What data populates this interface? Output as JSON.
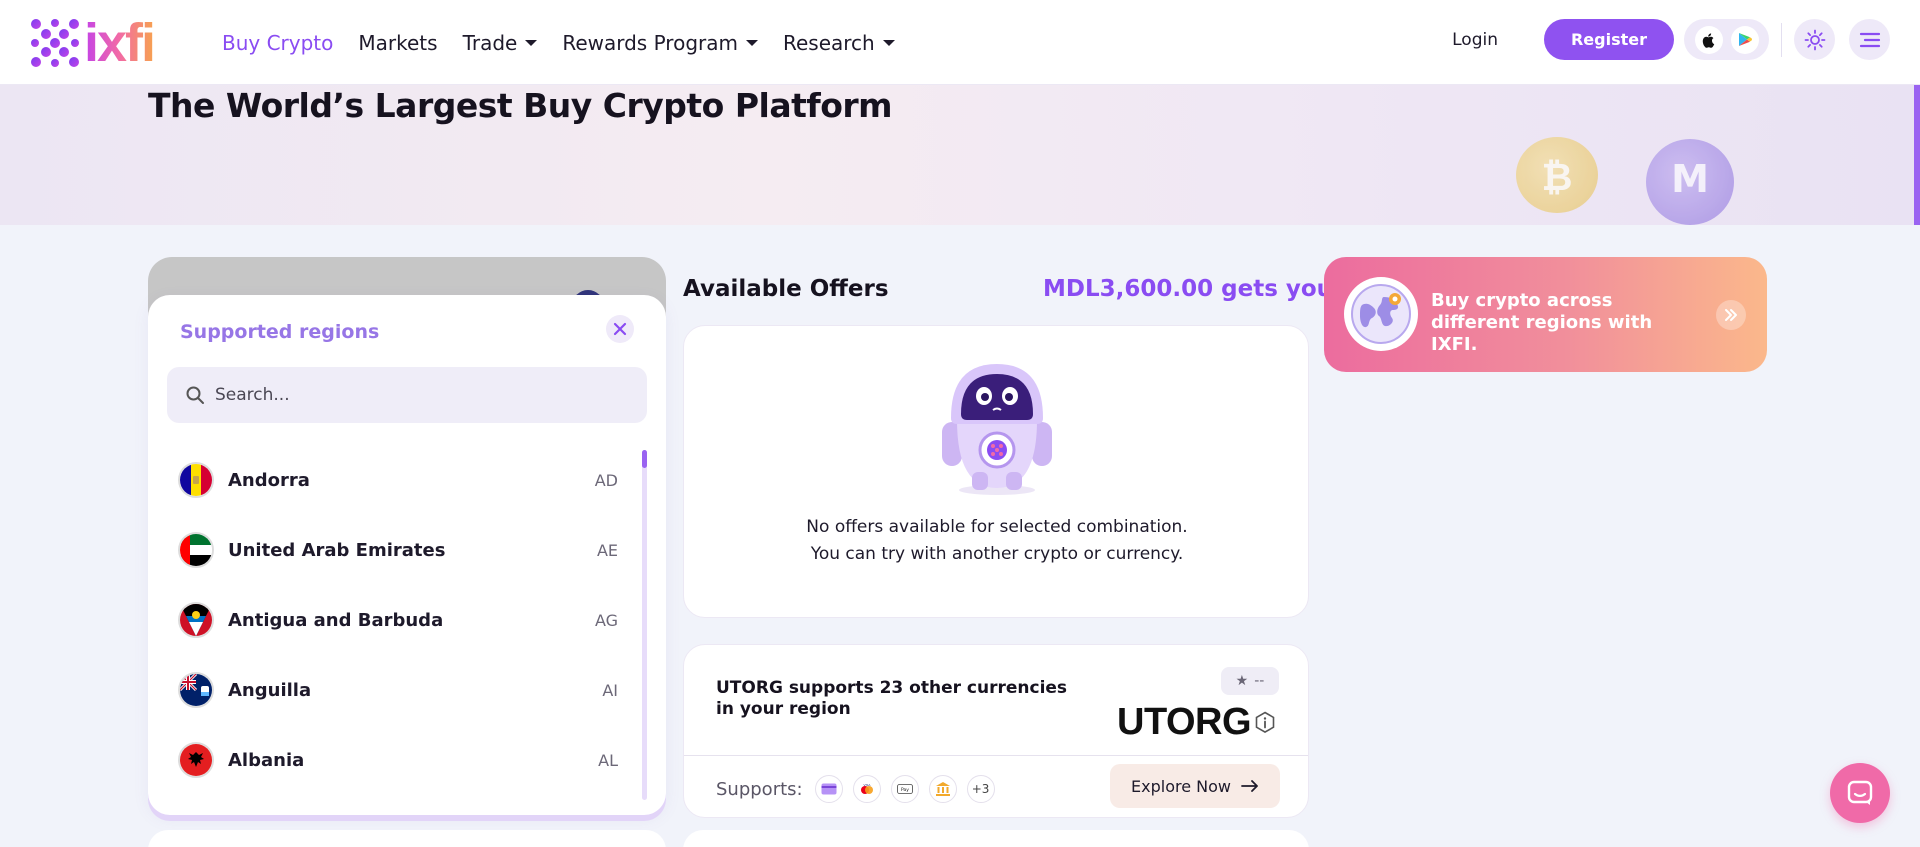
{
  "header": {
    "logo_text": "ixfi",
    "nav": [
      {
        "label": "Buy Crypto",
        "active": true,
        "has_caret": false
      },
      {
        "label": "Markets",
        "active": false,
        "has_caret": false
      },
      {
        "label": "Trade",
        "active": false,
        "has_caret": true
      },
      {
        "label": "Rewards Program",
        "active": false,
        "has_caret": true
      },
      {
        "label": "Research",
        "active": false,
        "has_caret": true
      }
    ],
    "login_label": "Login",
    "register_label": "Register",
    "icons": [
      "apple-icon",
      "google-play-icon",
      "sun-icon",
      "menu-icon"
    ]
  },
  "banner": {
    "title": "The World’s Largest Buy Crypto Platform"
  },
  "regions": {
    "title": "Supported regions",
    "search_placeholder": "Search...",
    "items": [
      {
        "name": "Andorra",
        "code": "AD"
      },
      {
        "name": "United Arab Emirates",
        "code": "AE"
      },
      {
        "name": "Antigua and Barbuda",
        "code": "AG"
      },
      {
        "name": "Anguilla",
        "code": "AI"
      },
      {
        "name": "Albania",
        "code": "AL"
      }
    ]
  },
  "offers": {
    "title": "Available Offers",
    "amount": "MDL3,600.00 gets you...",
    "empty_line1": "No offers available for selected combination.",
    "empty_line2": "You can try with another crypto or currency."
  },
  "provider": {
    "text": "UTORG supports 23 other currencies in your region",
    "rating": "--",
    "logo": "UTORG",
    "supports_label": "Supports:",
    "more_count": "+3",
    "payment_icons": [
      "card-icon",
      "mastercard-icon",
      "apple-pay-icon",
      "bank-icon"
    ],
    "explore_label": "Explore Now"
  },
  "promo": {
    "text": "Buy crypto across different regions with IXFI."
  },
  "colors": {
    "accent": "#8a4cf2",
    "register": "#8f52f0",
    "promo_start": "#ec6c9e",
    "promo_end": "#fbb88b",
    "chat": "#f06aa8"
  }
}
